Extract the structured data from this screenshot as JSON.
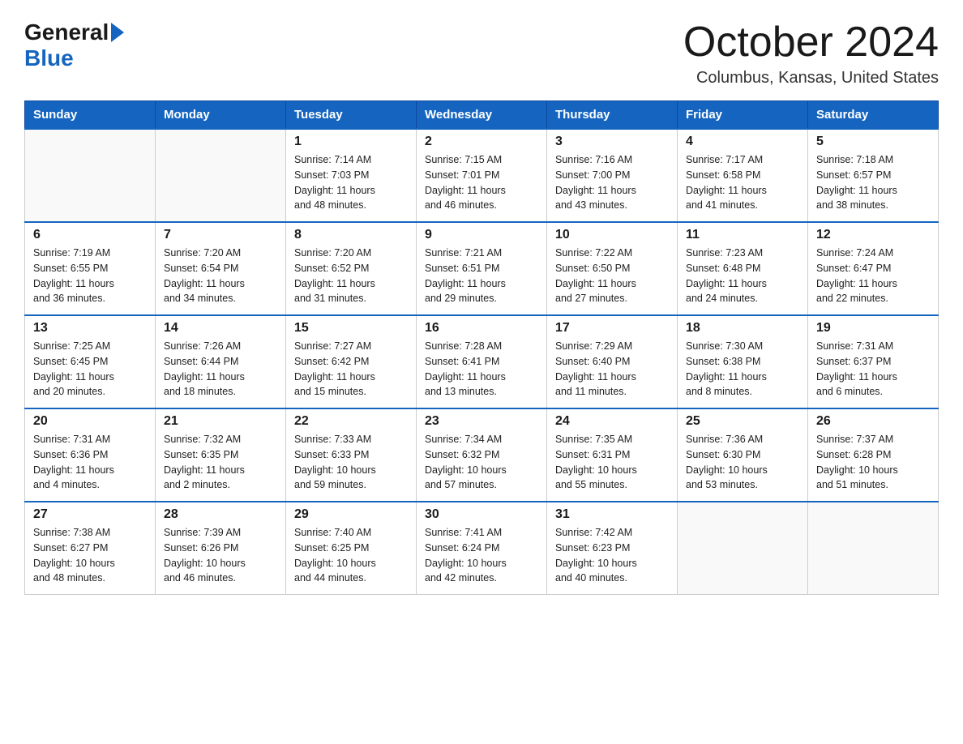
{
  "header": {
    "logo_general": "General",
    "logo_blue": "Blue",
    "month_title": "October 2024",
    "location": "Columbus, Kansas, United States"
  },
  "calendar": {
    "days_of_week": [
      "Sunday",
      "Monday",
      "Tuesday",
      "Wednesday",
      "Thursday",
      "Friday",
      "Saturday"
    ],
    "weeks": [
      [
        {
          "day": "",
          "info": ""
        },
        {
          "day": "",
          "info": ""
        },
        {
          "day": "1",
          "info": "Sunrise: 7:14 AM\nSunset: 7:03 PM\nDaylight: 11 hours\nand 48 minutes."
        },
        {
          "day": "2",
          "info": "Sunrise: 7:15 AM\nSunset: 7:01 PM\nDaylight: 11 hours\nand 46 minutes."
        },
        {
          "day": "3",
          "info": "Sunrise: 7:16 AM\nSunset: 7:00 PM\nDaylight: 11 hours\nand 43 minutes."
        },
        {
          "day": "4",
          "info": "Sunrise: 7:17 AM\nSunset: 6:58 PM\nDaylight: 11 hours\nand 41 minutes."
        },
        {
          "day": "5",
          "info": "Sunrise: 7:18 AM\nSunset: 6:57 PM\nDaylight: 11 hours\nand 38 minutes."
        }
      ],
      [
        {
          "day": "6",
          "info": "Sunrise: 7:19 AM\nSunset: 6:55 PM\nDaylight: 11 hours\nand 36 minutes."
        },
        {
          "day": "7",
          "info": "Sunrise: 7:20 AM\nSunset: 6:54 PM\nDaylight: 11 hours\nand 34 minutes."
        },
        {
          "day": "8",
          "info": "Sunrise: 7:20 AM\nSunset: 6:52 PM\nDaylight: 11 hours\nand 31 minutes."
        },
        {
          "day": "9",
          "info": "Sunrise: 7:21 AM\nSunset: 6:51 PM\nDaylight: 11 hours\nand 29 minutes."
        },
        {
          "day": "10",
          "info": "Sunrise: 7:22 AM\nSunset: 6:50 PM\nDaylight: 11 hours\nand 27 minutes."
        },
        {
          "day": "11",
          "info": "Sunrise: 7:23 AM\nSunset: 6:48 PM\nDaylight: 11 hours\nand 24 minutes."
        },
        {
          "day": "12",
          "info": "Sunrise: 7:24 AM\nSunset: 6:47 PM\nDaylight: 11 hours\nand 22 minutes."
        }
      ],
      [
        {
          "day": "13",
          "info": "Sunrise: 7:25 AM\nSunset: 6:45 PM\nDaylight: 11 hours\nand 20 minutes."
        },
        {
          "day": "14",
          "info": "Sunrise: 7:26 AM\nSunset: 6:44 PM\nDaylight: 11 hours\nand 18 minutes."
        },
        {
          "day": "15",
          "info": "Sunrise: 7:27 AM\nSunset: 6:42 PM\nDaylight: 11 hours\nand 15 minutes."
        },
        {
          "day": "16",
          "info": "Sunrise: 7:28 AM\nSunset: 6:41 PM\nDaylight: 11 hours\nand 13 minutes."
        },
        {
          "day": "17",
          "info": "Sunrise: 7:29 AM\nSunset: 6:40 PM\nDaylight: 11 hours\nand 11 minutes."
        },
        {
          "day": "18",
          "info": "Sunrise: 7:30 AM\nSunset: 6:38 PM\nDaylight: 11 hours\nand 8 minutes."
        },
        {
          "day": "19",
          "info": "Sunrise: 7:31 AM\nSunset: 6:37 PM\nDaylight: 11 hours\nand 6 minutes."
        }
      ],
      [
        {
          "day": "20",
          "info": "Sunrise: 7:31 AM\nSunset: 6:36 PM\nDaylight: 11 hours\nand 4 minutes."
        },
        {
          "day": "21",
          "info": "Sunrise: 7:32 AM\nSunset: 6:35 PM\nDaylight: 11 hours\nand 2 minutes."
        },
        {
          "day": "22",
          "info": "Sunrise: 7:33 AM\nSunset: 6:33 PM\nDaylight: 10 hours\nand 59 minutes."
        },
        {
          "day": "23",
          "info": "Sunrise: 7:34 AM\nSunset: 6:32 PM\nDaylight: 10 hours\nand 57 minutes."
        },
        {
          "day": "24",
          "info": "Sunrise: 7:35 AM\nSunset: 6:31 PM\nDaylight: 10 hours\nand 55 minutes."
        },
        {
          "day": "25",
          "info": "Sunrise: 7:36 AM\nSunset: 6:30 PM\nDaylight: 10 hours\nand 53 minutes."
        },
        {
          "day": "26",
          "info": "Sunrise: 7:37 AM\nSunset: 6:28 PM\nDaylight: 10 hours\nand 51 minutes."
        }
      ],
      [
        {
          "day": "27",
          "info": "Sunrise: 7:38 AM\nSunset: 6:27 PM\nDaylight: 10 hours\nand 48 minutes."
        },
        {
          "day": "28",
          "info": "Sunrise: 7:39 AM\nSunset: 6:26 PM\nDaylight: 10 hours\nand 46 minutes."
        },
        {
          "day": "29",
          "info": "Sunrise: 7:40 AM\nSunset: 6:25 PM\nDaylight: 10 hours\nand 44 minutes."
        },
        {
          "day": "30",
          "info": "Sunrise: 7:41 AM\nSunset: 6:24 PM\nDaylight: 10 hours\nand 42 minutes."
        },
        {
          "day": "31",
          "info": "Sunrise: 7:42 AM\nSunset: 6:23 PM\nDaylight: 10 hours\nand 40 minutes."
        },
        {
          "day": "",
          "info": ""
        },
        {
          "day": "",
          "info": ""
        }
      ]
    ]
  }
}
